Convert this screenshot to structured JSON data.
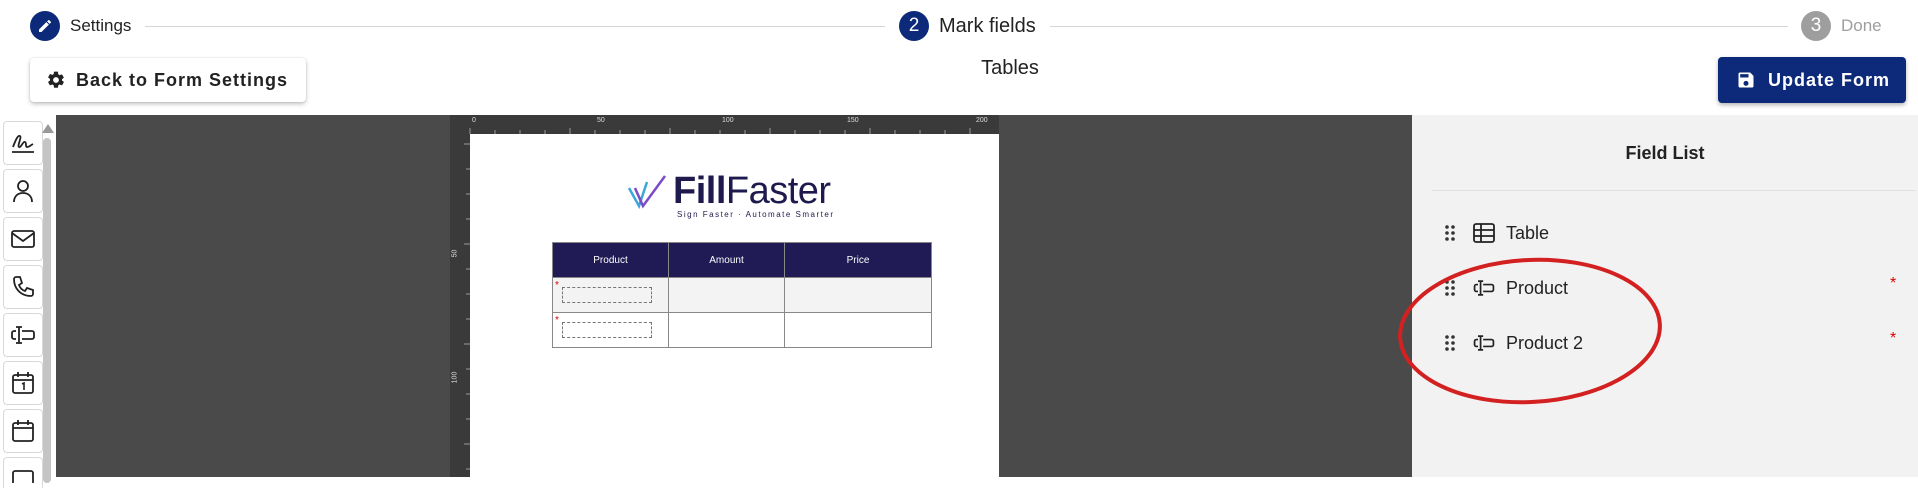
{
  "stepper": {
    "steps": [
      {
        "number": "",
        "label": "Settings",
        "icon": "pencil-icon"
      },
      {
        "number": "2",
        "label": "Mark fields"
      },
      {
        "number": "3",
        "label": "Done"
      }
    ]
  },
  "toolbar": {
    "back_label": "Back to Form Settings",
    "back_icon": "gear-icon",
    "title": "Tables",
    "update_label": "Update Form",
    "update_icon": "save-icon"
  },
  "toolbox": {
    "tools": [
      "signature-icon",
      "person-icon",
      "email-icon",
      "phone-icon",
      "text-field-icon",
      "date-icon",
      "calendar-icon"
    ]
  },
  "document": {
    "ruler_top": [
      "0",
      "50",
      "100",
      "150",
      "200"
    ],
    "ruler_left": [
      "50",
      "100"
    ],
    "logo": {
      "text_bold": "Fill",
      "text_light": "Faster",
      "tagline": "Sign Faster · Automate Smarter"
    },
    "table": {
      "headers": [
        "Product",
        "Amount",
        "Price"
      ]
    }
  },
  "field_list": {
    "title": "Field List",
    "items": [
      {
        "label": "Table",
        "icon": "table-icon",
        "required": false
      },
      {
        "label": "Product",
        "icon": "text-field-icon",
        "required": true
      },
      {
        "label": "Product 2",
        "icon": "text-field-icon",
        "required": true
      }
    ],
    "required_mark": "*"
  },
  "colors": {
    "primary": "#0d2a7a",
    "canvas": "#4a4a4a",
    "table_header": "#201a55",
    "annotation": "#d32020"
  }
}
